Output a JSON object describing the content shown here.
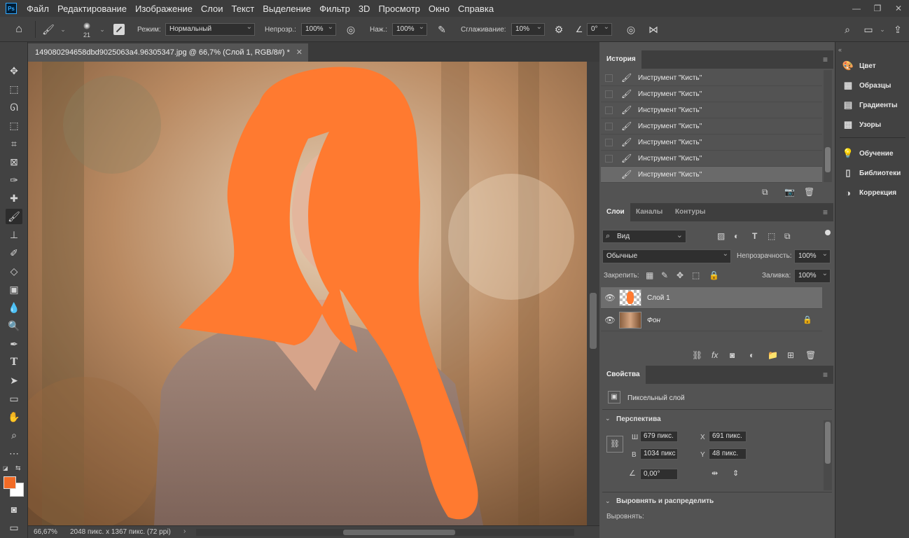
{
  "app": {
    "logo_text": "Ps"
  },
  "menu": [
    "Файл",
    "Редактирование",
    "Изображение",
    "Слои",
    "Текст",
    "Выделение",
    "Фильтр",
    "3D",
    "Просмотр",
    "Окно",
    "Справка"
  ],
  "window_controls": [
    "—",
    "❐",
    "✕"
  ],
  "options": {
    "brush_size": "21",
    "mode_label": "Режим:",
    "mode_value": "Нормальный",
    "opacity_label": "Непрозр.:",
    "opacity_value": "100%",
    "pressure_label": "Наж.:",
    "pressure_value": "100%",
    "smoothing_label": "Сглаживание:",
    "smoothing_value": "10%",
    "angle_value": "0°"
  },
  "document": {
    "tab_title": "149080294658dbd9025063a4.96305347.jpg @ 66,7% (Слой 1, RGB/8#) *",
    "close": "✕",
    "zoom": "66,67%",
    "info": "2048 пикс. x 1367 пикс. (72 ppi)"
  },
  "colors": {
    "foreground": "#f26b26",
    "background": "#ffffff",
    "paint": "#ff7a30"
  },
  "history": {
    "tab": "История",
    "items": [
      "Инструмент \"Кисть\"",
      "Инструмент \"Кисть\"",
      "Инструмент \"Кисть\"",
      "Инструмент \"Кисть\"",
      "Инструмент \"Кисть\"",
      "Инструмент \"Кисть\"",
      "Инструмент \"Кисть\""
    ]
  },
  "layers": {
    "tabs": [
      "Слои",
      "Каналы",
      "Контуры"
    ],
    "filter_value": "Вид",
    "blend_value": "Обычные",
    "opacity_label": "Непрозрачность:",
    "opacity_value": "100%",
    "lock_label": "Закрепить:",
    "fill_label": "Заливка:",
    "fill_value": "100%",
    "items": [
      {
        "name": "Слой 1"
      },
      {
        "name": "Фон"
      }
    ]
  },
  "properties": {
    "tab": "Свойства",
    "type": "Пиксельный слой",
    "section_transform": "Перспектива",
    "w_label": "Ш",
    "w_value": "679 пикс.",
    "h_label": "В",
    "h_value": "1034 пикс",
    "x_label": "X",
    "x_value": "691 пикс.",
    "y_label": "Y",
    "y_value": "48 пикс.",
    "angle_value": "0,00°",
    "section_align": "Выровнять и распределить",
    "align_label": "Выровнять:"
  },
  "dock": [
    "Цвет",
    "Образцы",
    "Градиенты",
    "Узоры",
    "Обучение",
    "Библиотеки",
    "Коррекция"
  ]
}
